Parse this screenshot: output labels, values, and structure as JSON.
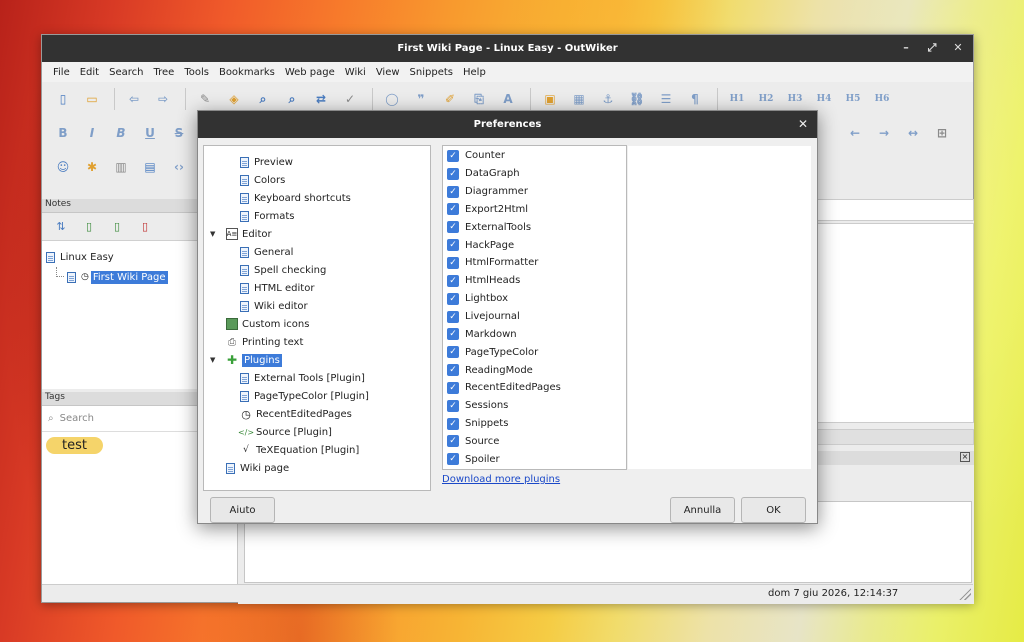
{
  "window": {
    "title": "First Wiki Page - Linux Easy - OutWiker",
    "controls": [
      "–",
      "⤢",
      "✕"
    ]
  },
  "menu": [
    "File",
    "Edit",
    "Search",
    "Tree",
    "Tools",
    "Bookmarks",
    "Web page",
    "Wiki",
    "View",
    "Snippets",
    "Help"
  ],
  "toolbar": {
    "headings": [
      "H1",
      "H2",
      "H3",
      "H4",
      "H5",
      "H6"
    ],
    "format": [
      "B",
      "I",
      "B",
      "U",
      "S"
    ],
    "arrows": [
      "←",
      "→",
      "↔"
    ]
  },
  "notes": {
    "header": "Notes",
    "root": "Linux Easy",
    "child": "First Wiki Page"
  },
  "tags": {
    "header": "Tags",
    "search_placeholder": "Search",
    "items": [
      "test"
    ]
  },
  "status": {
    "datetime": "dom 7 giu 2026, 12:14:37"
  },
  "dialog": {
    "title": "Preferences",
    "tree": {
      "preview": "Preview",
      "colors": "Colors",
      "shortcuts": "Keyboard shortcuts",
      "formats": "Formats",
      "editor": "Editor",
      "general": "General",
      "spell": "Spell checking",
      "html_editor": "HTML editor",
      "wiki_editor": "Wiki editor",
      "custom_icons": "Custom icons",
      "printing": "Printing text",
      "plugins": "Plugins",
      "external_tools": "External Tools [Plugin]",
      "page_type_color": "PageTypeColor [Plugin]",
      "recent_edited": "RecentEditedPages",
      "source": "Source [Plugin]",
      "texequation": "TeXEquation [Plugin]",
      "wiki_page": "Wiki page"
    },
    "plugins": [
      "Counter",
      "DataGraph",
      "Diagrammer",
      "Export2Html",
      "ExternalTools",
      "HackPage",
      "HtmlFormatter",
      "HtmlHeads",
      "Lightbox",
      "Livejournal",
      "Markdown",
      "PageTypeColor",
      "ReadingMode",
      "RecentEditedPages",
      "Sessions",
      "Snippets",
      "Source",
      "Spoiler"
    ],
    "download_link": "Download more plugins",
    "buttons": {
      "help": "Aiuto",
      "cancel": "Annulla",
      "ok": "OK"
    }
  }
}
